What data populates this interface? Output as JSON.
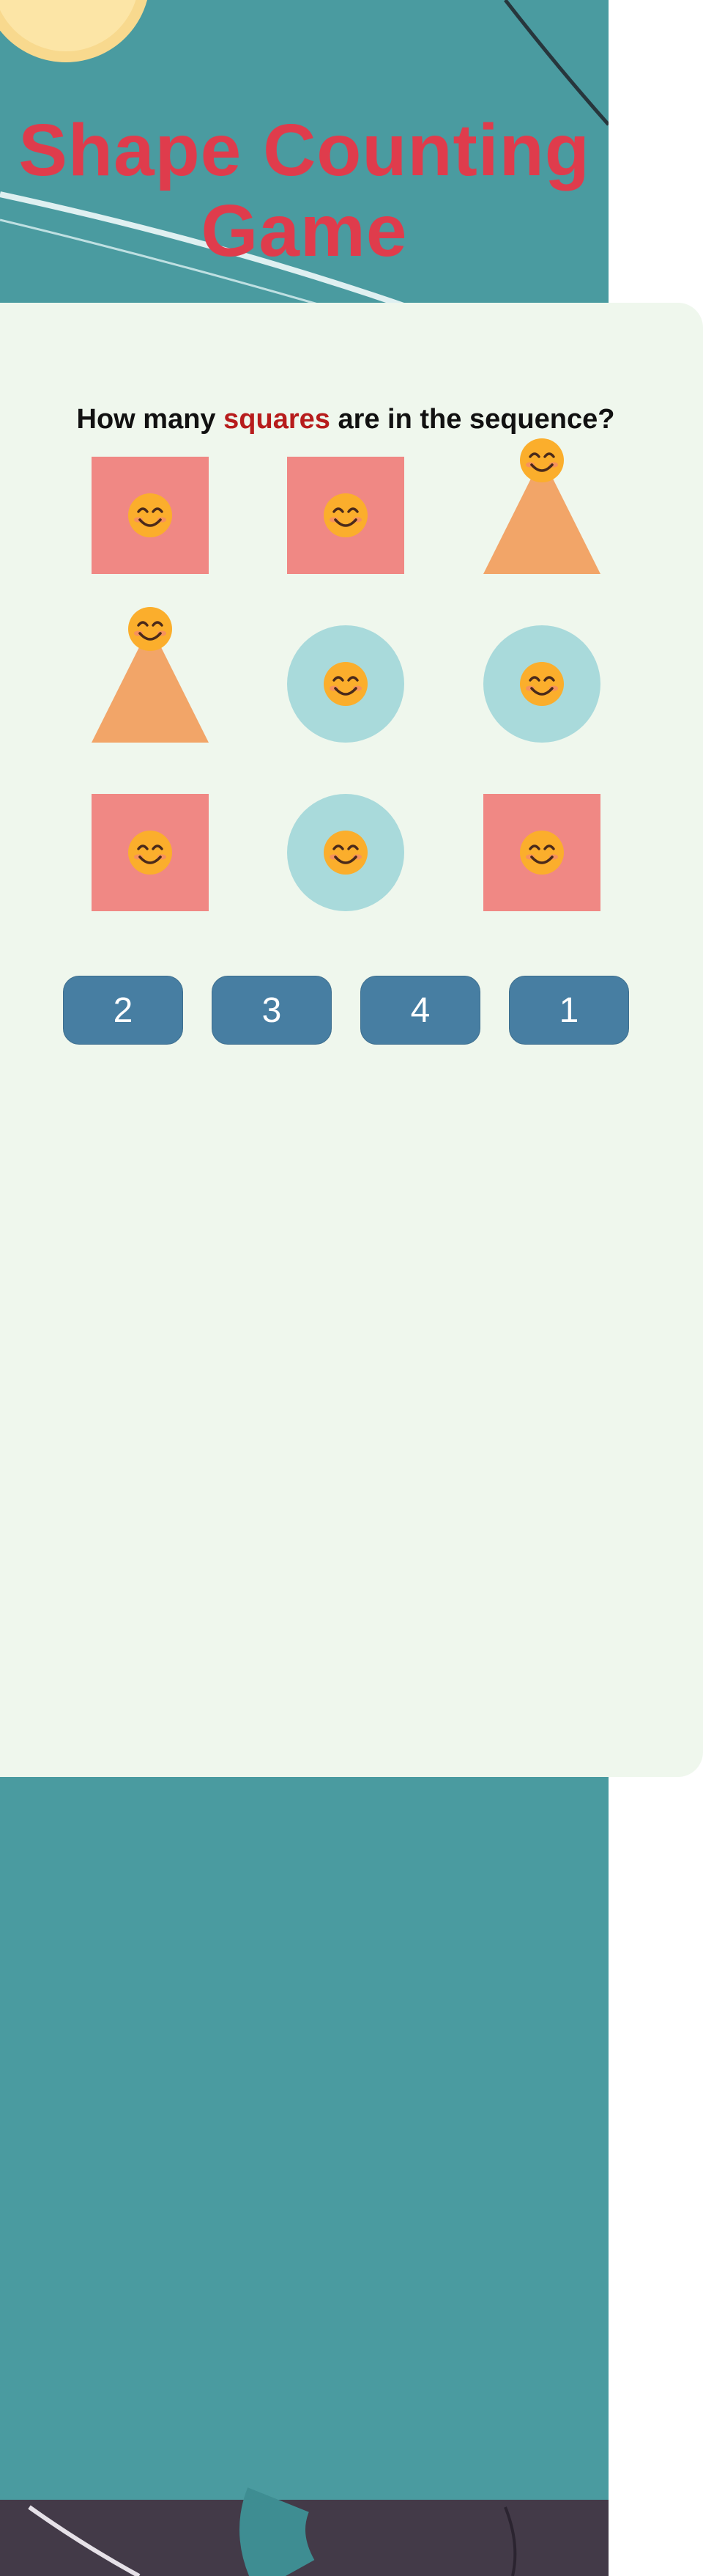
{
  "game": {
    "title": "Shape Counting Game",
    "question": {
      "prefix": "How many ",
      "target_word": "squares",
      "suffix": " are in the sequence?"
    },
    "grid": [
      {
        "shape": "square",
        "icon": "smiling-face-icon"
      },
      {
        "shape": "square",
        "icon": "smiling-face-icon"
      },
      {
        "shape": "triangle",
        "icon": "smiling-face-icon"
      },
      {
        "shape": "triangle",
        "icon": "smiling-face-icon"
      },
      {
        "shape": "circle",
        "icon": "smiling-face-icon"
      },
      {
        "shape": "circle",
        "icon": "smiling-face-icon"
      },
      {
        "shape": "square",
        "icon": "smiling-face-icon"
      },
      {
        "shape": "circle",
        "icon": "smiling-face-icon"
      },
      {
        "shape": "square",
        "icon": "smiling-face-icon"
      }
    ],
    "answers": [
      "2",
      "3",
      "4",
      "1"
    ]
  },
  "colors": {
    "title": "#df3c4c",
    "highlight": "#b71c1c",
    "panel_background": "#eff7ed",
    "square": "#f08884",
    "circle": "#a9dadb",
    "triangle": "#f2a568",
    "button": "#477ea2",
    "background_teal": "#4a9ba0"
  }
}
